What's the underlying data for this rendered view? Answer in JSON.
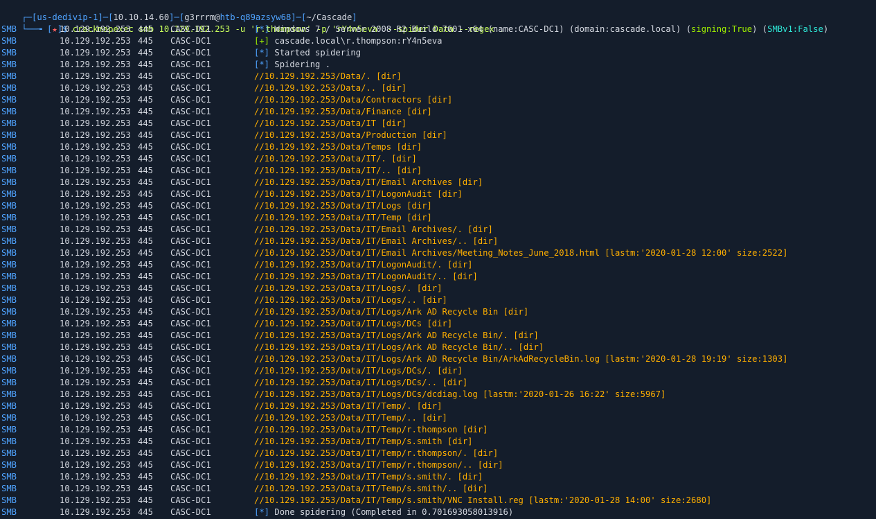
{
  "colors": {
    "background": "#141d2b",
    "blue": "#4fa3ff",
    "white": "#d4d8e0",
    "yellow_green": "#c9ff5c",
    "green": "#9fef00",
    "orange": "#ffaf00",
    "cyan": "#2ee6d6",
    "red": "#ff5f5f"
  },
  "prompt": {
    "line1": {
      "box_start": "┌─[",
      "host": "us-dedivip-1",
      "sep1": "]─[",
      "ip": "10.10.14.60",
      "sep2": "]─[",
      "user": "g3rrrm",
      "at": "@",
      "machine": "htb-q89azsyw68",
      "sep3": "]─[",
      "dir": "~/Cascade",
      "box_end": "]"
    },
    "line2": {
      "box_start": "└──╼ [",
      "star": "★",
      "box_end": "]$ ",
      "command": "crackmapexec smb 10.129.192.253 -u 'r.thompson' -p 'rY4n5eva' --spider Data --regex ."
    }
  },
  "output": {
    "proto": "SMB",
    "ip": "10.129.192.253",
    "port": "445",
    "host": "CASC-DC1",
    "rows": [
      {
        "tag": "[*]",
        "tag_class": "tag-info",
        "parts": [
          {
            "t": " Windows 7 / Server 2008 R2 Build 7601 x64 (name:CASC-DC1) (domain:cascade.local) (",
            "c": "msg-white"
          },
          {
            "t": "signing:True",
            "c": "hl-green"
          },
          {
            "t": ") (",
            "c": "msg-white"
          },
          {
            "t": "SMBv1:False",
            "c": "hl-cyan"
          },
          {
            "t": ")",
            "c": "msg-white"
          }
        ]
      },
      {
        "tag": "[+]",
        "tag_class": "tag-plus",
        "parts": [
          {
            "t": " cascade.local\\r.thompson:rY4n5eva",
            "c": "msg-white"
          }
        ]
      },
      {
        "tag": "[*]",
        "tag_class": "tag-info",
        "parts": [
          {
            "t": " Started spidering",
            "c": "msg-white"
          }
        ]
      },
      {
        "tag": "[*]",
        "tag_class": "tag-info",
        "parts": [
          {
            "t": " Spidering .",
            "c": "msg-white"
          }
        ]
      },
      {
        "tag": "",
        "parts": [
          {
            "t": "//10.129.192.253/Data/. [dir]",
            "c": "msg-path"
          }
        ]
      },
      {
        "tag": "",
        "parts": [
          {
            "t": "//10.129.192.253/Data/.. [dir]",
            "c": "msg-path"
          }
        ]
      },
      {
        "tag": "",
        "parts": [
          {
            "t": "//10.129.192.253/Data/Contractors [dir]",
            "c": "msg-path"
          }
        ]
      },
      {
        "tag": "",
        "parts": [
          {
            "t": "//10.129.192.253/Data/Finance [dir]",
            "c": "msg-path"
          }
        ]
      },
      {
        "tag": "",
        "parts": [
          {
            "t": "//10.129.192.253/Data/IT [dir]",
            "c": "msg-path"
          }
        ]
      },
      {
        "tag": "",
        "parts": [
          {
            "t": "//10.129.192.253/Data/Production [dir]",
            "c": "msg-path"
          }
        ]
      },
      {
        "tag": "",
        "parts": [
          {
            "t": "//10.129.192.253/Data/Temps [dir]",
            "c": "msg-path"
          }
        ]
      },
      {
        "tag": "",
        "parts": [
          {
            "t": "//10.129.192.253/Data/IT/. [dir]",
            "c": "msg-path"
          }
        ]
      },
      {
        "tag": "",
        "parts": [
          {
            "t": "//10.129.192.253/Data/IT/.. [dir]",
            "c": "msg-path"
          }
        ]
      },
      {
        "tag": "",
        "parts": [
          {
            "t": "//10.129.192.253/Data/IT/Email Archives [dir]",
            "c": "msg-path"
          }
        ]
      },
      {
        "tag": "",
        "parts": [
          {
            "t": "//10.129.192.253/Data/IT/LogonAudit [dir]",
            "c": "msg-path"
          }
        ]
      },
      {
        "tag": "",
        "parts": [
          {
            "t": "//10.129.192.253/Data/IT/Logs [dir]",
            "c": "msg-path"
          }
        ]
      },
      {
        "tag": "",
        "parts": [
          {
            "t": "//10.129.192.253/Data/IT/Temp [dir]",
            "c": "msg-path"
          }
        ]
      },
      {
        "tag": "",
        "parts": [
          {
            "t": "//10.129.192.253/Data/IT/Email Archives/. [dir]",
            "c": "msg-path"
          }
        ]
      },
      {
        "tag": "",
        "parts": [
          {
            "t": "//10.129.192.253/Data/IT/Email Archives/.. [dir]",
            "c": "msg-path"
          }
        ]
      },
      {
        "tag": "",
        "parts": [
          {
            "t": "//10.129.192.253/Data/IT/Email Archives/Meeting_Notes_June_2018.html [lastm:'2020-01-28 12:00' size:2522]",
            "c": "msg-path"
          }
        ]
      },
      {
        "tag": "",
        "parts": [
          {
            "t": "//10.129.192.253/Data/IT/LogonAudit/. [dir]",
            "c": "msg-path"
          }
        ]
      },
      {
        "tag": "",
        "parts": [
          {
            "t": "//10.129.192.253/Data/IT/LogonAudit/.. [dir]",
            "c": "msg-path"
          }
        ]
      },
      {
        "tag": "",
        "parts": [
          {
            "t": "//10.129.192.253/Data/IT/Logs/. [dir]",
            "c": "msg-path"
          }
        ]
      },
      {
        "tag": "",
        "parts": [
          {
            "t": "//10.129.192.253/Data/IT/Logs/.. [dir]",
            "c": "msg-path"
          }
        ]
      },
      {
        "tag": "",
        "parts": [
          {
            "t": "//10.129.192.253/Data/IT/Logs/Ark AD Recycle Bin [dir]",
            "c": "msg-path"
          }
        ]
      },
      {
        "tag": "",
        "parts": [
          {
            "t": "//10.129.192.253/Data/IT/Logs/DCs [dir]",
            "c": "msg-path"
          }
        ]
      },
      {
        "tag": "",
        "parts": [
          {
            "t": "//10.129.192.253/Data/IT/Logs/Ark AD Recycle Bin/. [dir]",
            "c": "msg-path"
          }
        ]
      },
      {
        "tag": "",
        "parts": [
          {
            "t": "//10.129.192.253/Data/IT/Logs/Ark AD Recycle Bin/.. [dir]",
            "c": "msg-path"
          }
        ]
      },
      {
        "tag": "",
        "parts": [
          {
            "t": "//10.129.192.253/Data/IT/Logs/Ark AD Recycle Bin/ArkAdRecycleBin.log [lastm:'2020-01-28 19:19' size:1303]",
            "c": "msg-path"
          }
        ]
      },
      {
        "tag": "",
        "parts": [
          {
            "t": "//10.129.192.253/Data/IT/Logs/DCs/. [dir]",
            "c": "msg-path"
          }
        ]
      },
      {
        "tag": "",
        "parts": [
          {
            "t": "//10.129.192.253/Data/IT/Logs/DCs/.. [dir]",
            "c": "msg-path"
          }
        ]
      },
      {
        "tag": "",
        "parts": [
          {
            "t": "//10.129.192.253/Data/IT/Logs/DCs/dcdiag.log [lastm:'2020-01-26 16:22' size:5967]",
            "c": "msg-path"
          }
        ]
      },
      {
        "tag": "",
        "parts": [
          {
            "t": "//10.129.192.253/Data/IT/Temp/. [dir]",
            "c": "msg-path"
          }
        ]
      },
      {
        "tag": "",
        "parts": [
          {
            "t": "//10.129.192.253/Data/IT/Temp/.. [dir]",
            "c": "msg-path"
          }
        ]
      },
      {
        "tag": "",
        "parts": [
          {
            "t": "//10.129.192.253/Data/IT/Temp/r.thompson [dir]",
            "c": "msg-path"
          }
        ]
      },
      {
        "tag": "",
        "parts": [
          {
            "t": "//10.129.192.253/Data/IT/Temp/s.smith [dir]",
            "c": "msg-path"
          }
        ]
      },
      {
        "tag": "",
        "parts": [
          {
            "t": "//10.129.192.253/Data/IT/Temp/r.thompson/. [dir]",
            "c": "msg-path"
          }
        ]
      },
      {
        "tag": "",
        "parts": [
          {
            "t": "//10.129.192.253/Data/IT/Temp/r.thompson/.. [dir]",
            "c": "msg-path"
          }
        ]
      },
      {
        "tag": "",
        "parts": [
          {
            "t": "//10.129.192.253/Data/IT/Temp/s.smith/. [dir]",
            "c": "msg-path"
          }
        ]
      },
      {
        "tag": "",
        "parts": [
          {
            "t": "//10.129.192.253/Data/IT/Temp/s.smith/.. [dir]",
            "c": "msg-path"
          }
        ]
      },
      {
        "tag": "",
        "parts": [
          {
            "t": "//10.129.192.253/Data/IT/Temp/s.smith/VNC Install.reg [lastm:'2020-01-28 14:00' size:2680]",
            "c": "msg-path"
          }
        ]
      },
      {
        "tag": "[*]",
        "tag_class": "tag-info",
        "parts": [
          {
            "t": " Done spidering (Completed in 0.701693058013916)",
            "c": "msg-white"
          }
        ]
      }
    ]
  }
}
